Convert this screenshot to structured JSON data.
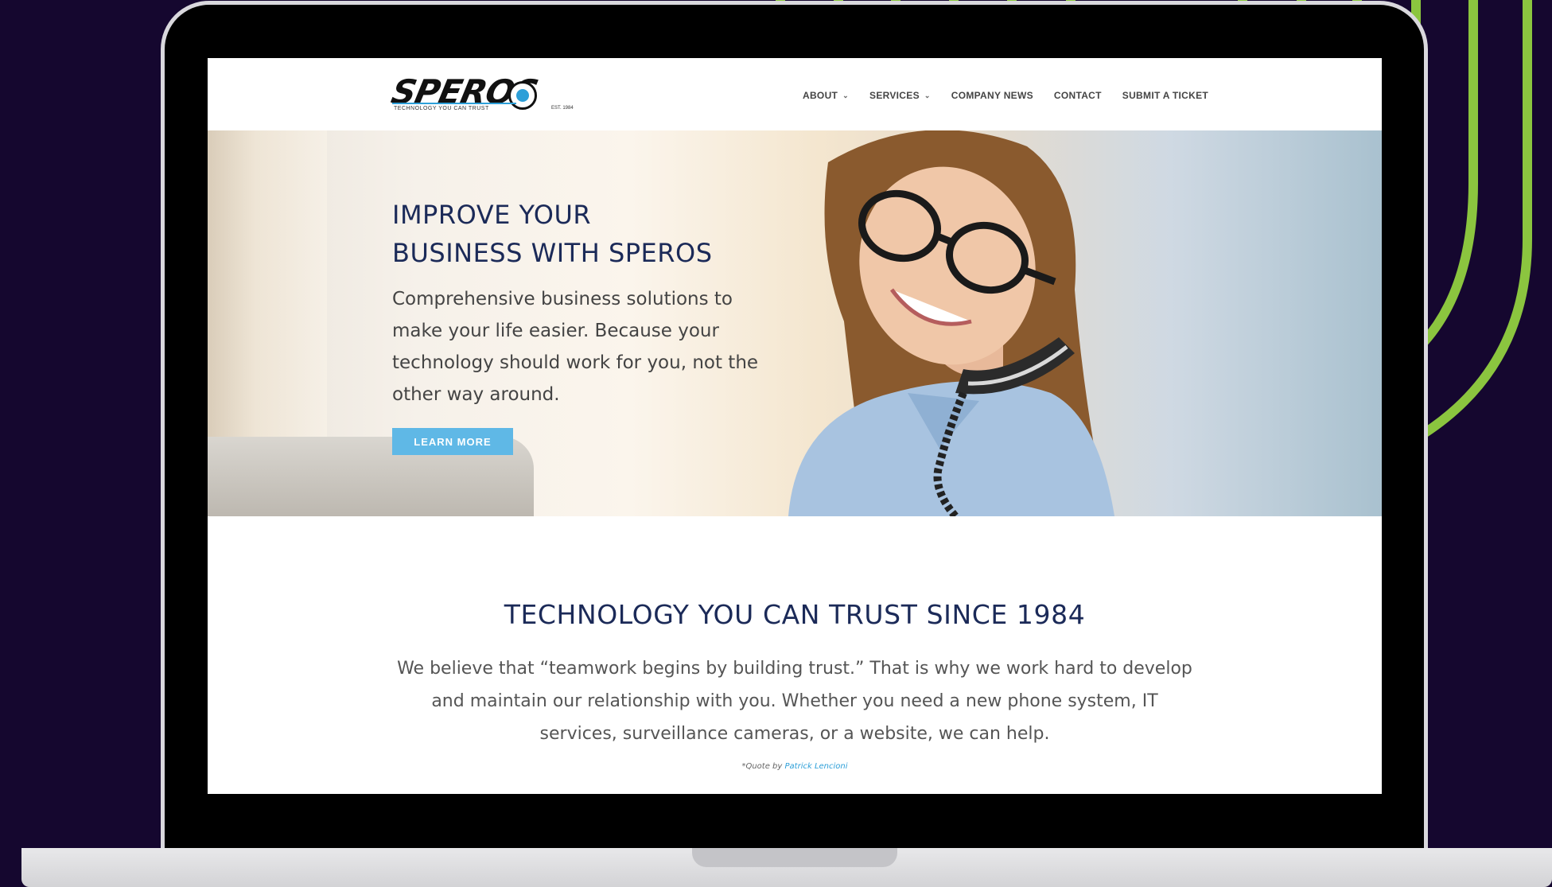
{
  "colors": {
    "page_background": "#15072f",
    "stripe": "#8bc53f",
    "heading_navy": "#1b2a58",
    "accent_blue": "#5fb8e6"
  },
  "logo": {
    "wordmark": "SPEROS",
    "tagline": "TECHNOLOGY YOU CAN TRUST",
    "est": "EST. 1984"
  },
  "nav": {
    "items": [
      {
        "label": "ABOUT",
        "has_dropdown": true
      },
      {
        "label": "SERVICES",
        "has_dropdown": true
      },
      {
        "label": "COMPANY NEWS",
        "has_dropdown": false
      },
      {
        "label": "CONTACT",
        "has_dropdown": false
      },
      {
        "label": "SUBMIT A TICKET",
        "has_dropdown": false
      }
    ]
  },
  "hero": {
    "title_line1": "IMPROVE YOUR",
    "title_line2": "BUSINESS WITH SPEROS",
    "text": "Comprehensive business solutions to make your life easier. Because your technology should work for you, not the other way around.",
    "button_label": "LEARN MORE"
  },
  "intro": {
    "title": "TECHNOLOGY YOU CAN TRUST SINCE 1984",
    "text": "We believe that “teamwork begins by building trust.” That is why we work hard to develop and maintain our relationship with you. Whether you need a new phone system, IT services, surveillance cameras, or a website, we can help.",
    "quote_prefix": "*Quote by",
    "quote_author": "Patrick Lencioni"
  }
}
